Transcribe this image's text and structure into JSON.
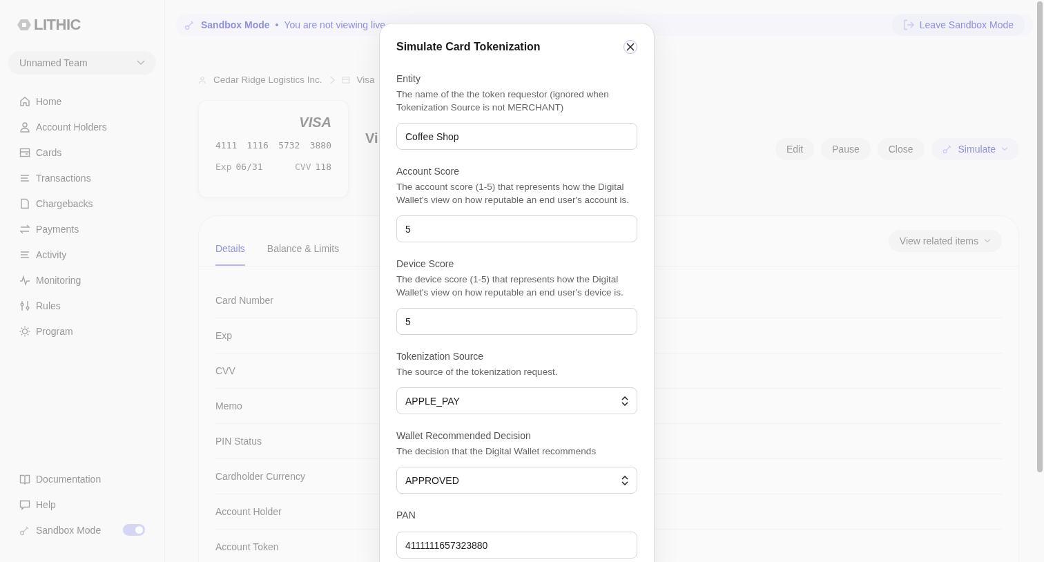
{
  "logo": "LITHIC",
  "team": "Unnamed Team",
  "nav": [
    {
      "label": "Home",
      "selected": false
    },
    {
      "label": "Account Holders",
      "selected": false
    },
    {
      "label": "Cards",
      "selected": false
    },
    {
      "label": "Transactions",
      "selected": false
    },
    {
      "label": "Chargebacks",
      "selected": false
    },
    {
      "label": "Payments",
      "selected": false
    },
    {
      "label": "Activity",
      "selected": false
    },
    {
      "label": "Monitoring",
      "selected": false
    },
    {
      "label": "Rules",
      "selected": false
    },
    {
      "label": "Program",
      "selected": false
    }
  ],
  "nav_bottom": [
    {
      "label": "Documentation"
    },
    {
      "label": "Help"
    }
  ],
  "sandbox_toggle": {
    "label": "Sandbox Mode",
    "on": true
  },
  "banner": {
    "title": "Sandbox Mode",
    "separator": "•",
    "text": "You are not viewing live",
    "button": "Leave Sandbox Mode"
  },
  "breadcrumb": [
    "Cedar Ridge Logistics Inc.",
    "Visa"
  ],
  "card": {
    "brand": "VISA",
    "number": [
      "4111",
      "1116",
      "5732",
      "3880"
    ],
    "exp_label": "Exp",
    "exp": "06/31",
    "cvv_label": "CVV",
    "cvv": "118"
  },
  "card_title": "Vi",
  "actions": [
    "Edit",
    "Pause",
    "Close"
  ],
  "simulate": "Simulate",
  "tabs": [
    {
      "label": "Details",
      "selected": true
    },
    {
      "label": "Balance & Limits",
      "selected": false
    }
  ],
  "related": "View related items",
  "details": [
    {
      "label": "Card Number"
    },
    {
      "label": "Exp"
    },
    {
      "label": "CVV"
    },
    {
      "label": "Memo"
    },
    {
      "label": "PIN Status"
    },
    {
      "label": "Cardholder Currency"
    },
    {
      "label": "Account Holder"
    },
    {
      "label": "Account Token"
    }
  ],
  "modal": {
    "title": "Simulate Card Tokenization",
    "fields": [
      {
        "kind": "text",
        "label": "Entity",
        "description": "The name of the the token requestor (ignored when Tokenization Source is not MERCHANT)",
        "value": "Coffee Shop"
      },
      {
        "kind": "text",
        "label": "Account Score",
        "description": "The account score (1-5) that represents how the Digital Wallet's view on how reputable an end user's account is.",
        "value": "5"
      },
      {
        "kind": "text",
        "label": "Device Score",
        "description": "The device score (1-5) that represents how the Digital Wallet's view on how reputable an end user's device is.",
        "value": "5"
      },
      {
        "kind": "select",
        "label": "Tokenization Source",
        "description": "The source of the tokenization request.",
        "value": "APPLE_PAY"
      },
      {
        "kind": "select",
        "label": "Wallet Recommended Decision",
        "description": "The decision that the Digital Wallet recommends",
        "value": "APPROVED"
      },
      {
        "kind": "text",
        "label": "PAN",
        "value": "4111111657323880"
      }
    ]
  }
}
